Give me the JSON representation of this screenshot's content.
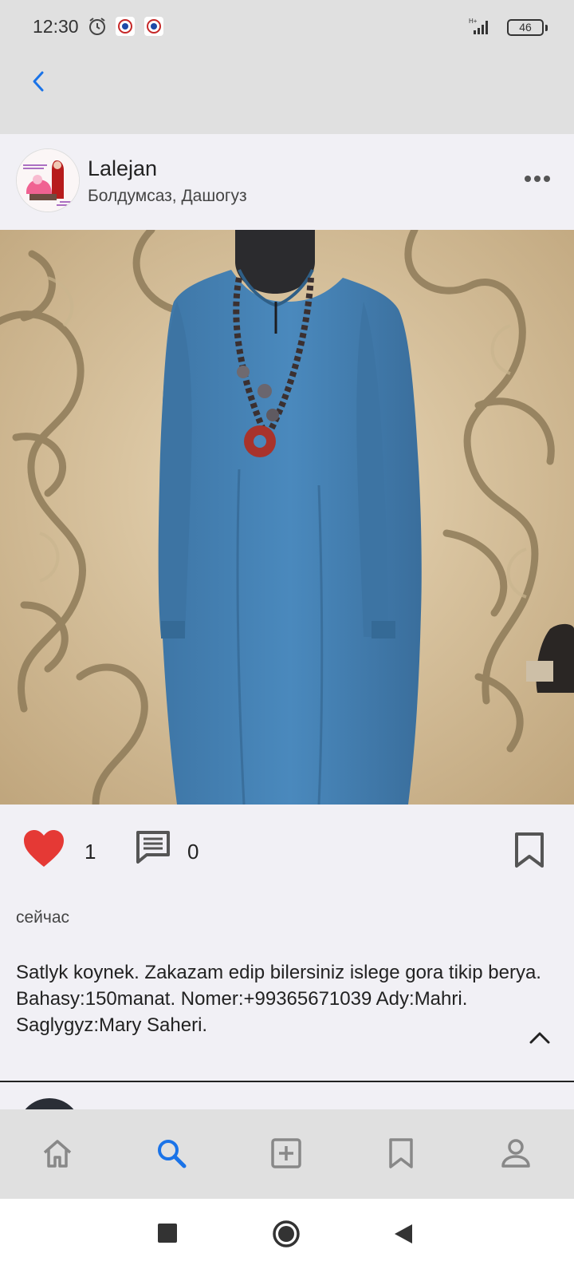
{
  "status_bar": {
    "time": "12:30",
    "battery": "46",
    "network": "H+"
  },
  "post": {
    "username": "Lalejan",
    "location": "Болдумсаз, Дашогуз",
    "likes": "1",
    "comments": "0",
    "timestamp": "сейчас",
    "caption": "Satlyk koynek. Zakazam edip bilersiniz islege gora tikip berya. Bahasy:150manat. Nomer:+99365671039 Ady:Mahri. Saglygyz:Mary Saheri."
  },
  "icons": {
    "back": "chevron-left-icon",
    "more": "more-horizontal-icon",
    "like": "heart-icon",
    "comment": "comment-icon",
    "bookmark": "bookmark-icon",
    "collapse": "chevron-up-icon"
  },
  "bottom_nav": [
    "home",
    "search",
    "add",
    "saved",
    "profile"
  ],
  "colors": {
    "accent": "#1a73e8",
    "like": "#e53935",
    "bar": "#e0e0e0",
    "page": "#f1f0f5"
  }
}
